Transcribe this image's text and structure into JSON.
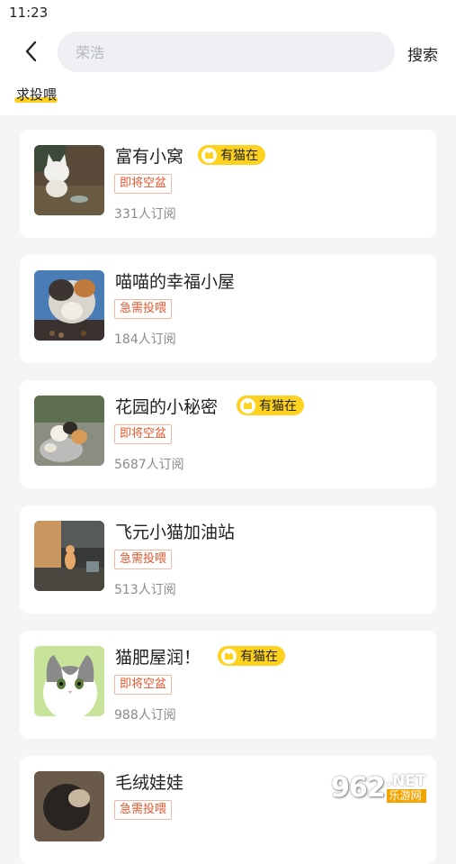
{
  "status_bar": {
    "time": "11:23"
  },
  "header": {
    "search_placeholder": "荣浩",
    "search_button": "搜索",
    "tab_label": "求投喂"
  },
  "badge_text": "有猫在",
  "cards": [
    {
      "name": "富有小窝",
      "tag": "即将空盆",
      "subscribers": "331人订阅",
      "has_cat": true
    },
    {
      "name": "喵喵的幸福小屋",
      "tag": "急需投喂",
      "subscribers": "184人订阅",
      "has_cat": false
    },
    {
      "name": "花园的小秘密",
      "tag": "即将空盆",
      "subscribers": "5687人订阅",
      "has_cat": true
    },
    {
      "name": "飞元小猫加油站",
      "tag": "急需投喂",
      "subscribers": "513人订阅",
      "has_cat": false
    },
    {
      "name": "猫肥屋润！",
      "tag": "即将空盆",
      "subscribers": "988人订阅",
      "has_cat": true
    },
    {
      "name": "毛绒娃娃",
      "tag": "急需投喂",
      "subscribers": "",
      "has_cat": false
    }
  ],
  "watermark": {
    "number": "962",
    "suffix": ".NET",
    "site": "乐游网"
  },
  "colors": {
    "accent": "#ffd21f",
    "tag_red": "#e4572e",
    "background": "#f5f5f5"
  },
  "icons": {
    "back": "chevron-left-icon",
    "cat_badge": "cat-head-icon"
  }
}
